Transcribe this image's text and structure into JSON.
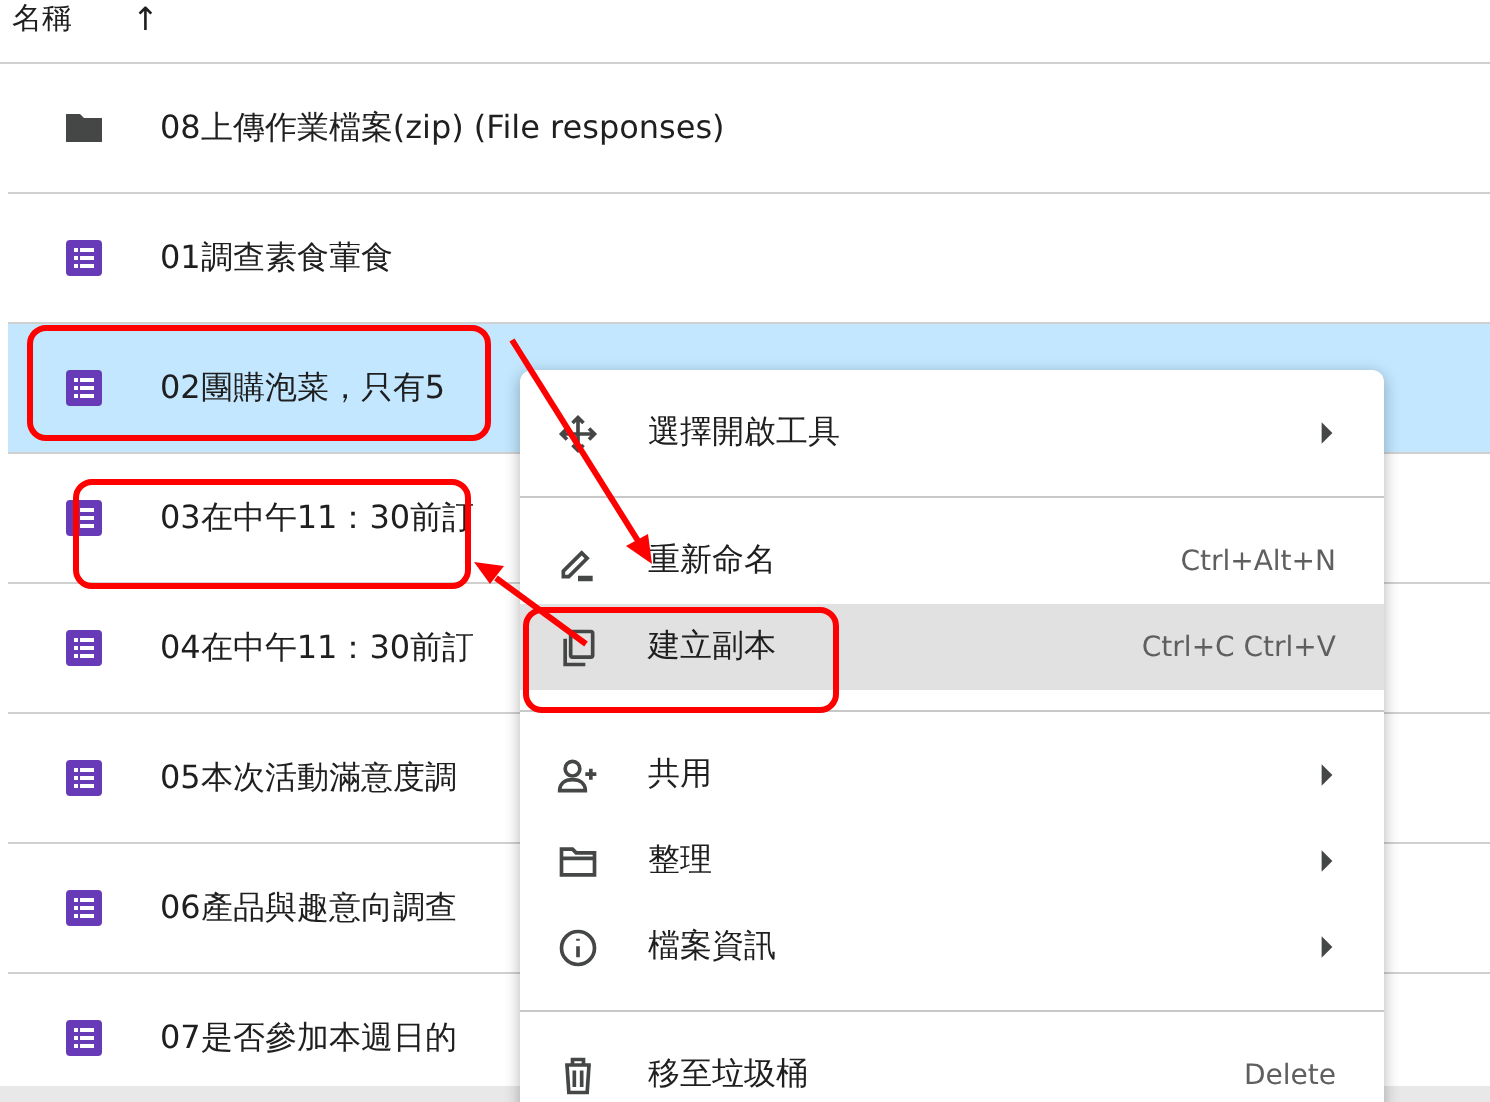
{
  "header": {
    "name_label": "名稱",
    "sort_arrow": "↑"
  },
  "rows": [
    {
      "kind": "folder",
      "name": "08上傳作業檔案(zip) (File responses)",
      "selected": false
    },
    {
      "kind": "form",
      "name": "01調查素食葷食",
      "selected": false
    },
    {
      "kind": "form",
      "name": "02團購泡菜，只有5",
      "selected": true
    },
    {
      "kind": "form",
      "name": "03在中午11：30前訂",
      "selected": false
    },
    {
      "kind": "form",
      "name": "04在中午11：30前訂",
      "selected": false
    },
    {
      "kind": "form",
      "name": "05本次活動滿意度調",
      "selected": false
    },
    {
      "kind": "form",
      "name": "06產品與趣意向調查",
      "selected": false
    },
    {
      "kind": "form",
      "name": "07是否參加本週日的",
      "selected": false
    }
  ],
  "context_menu": {
    "items": [
      {
        "label": "選擇開啟工具",
        "submenu": true,
        "highlighted": false,
        "divider_after": true
      },
      {
        "label": "重新命名",
        "shortcut": "Ctrl+Alt+N",
        "submenu": false,
        "highlighted": false,
        "divider_after": false
      },
      {
        "label": "建立副本",
        "shortcut": "Ctrl+C Ctrl+V",
        "submenu": false,
        "highlighted": true,
        "divider_after": true
      },
      {
        "label": "共用",
        "submenu": true,
        "highlighted": false,
        "divider_after": false
      },
      {
        "label": "整理",
        "submenu": true,
        "highlighted": false,
        "divider_after": false
      },
      {
        "label": "檔案資訊",
        "submenu": true,
        "highlighted": false,
        "divider_after": true
      },
      {
        "label": "移至垃圾桶",
        "shortcut": "Delete",
        "submenu": false,
        "highlighted": false
      }
    ]
  }
}
